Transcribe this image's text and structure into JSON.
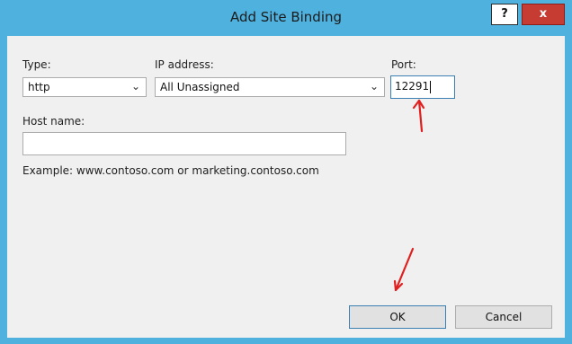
{
  "window": {
    "title": "Add Site Binding",
    "help_label": "?",
    "close_label": "x"
  },
  "form": {
    "type": {
      "label": "Type:",
      "value": "http"
    },
    "ip_address": {
      "label": "IP address:",
      "value": "All Unassigned"
    },
    "port": {
      "label": "Port:",
      "value": "12291"
    },
    "host_name": {
      "label": "Host name:",
      "value": ""
    },
    "example": "Example: www.contoso.com or marketing.contoso.com"
  },
  "buttons": {
    "ok": "OK",
    "cancel": "Cancel"
  },
  "colors": {
    "titlebar": "#4fb1dd",
    "close": "#c73c32",
    "annotation": "#e02020"
  }
}
